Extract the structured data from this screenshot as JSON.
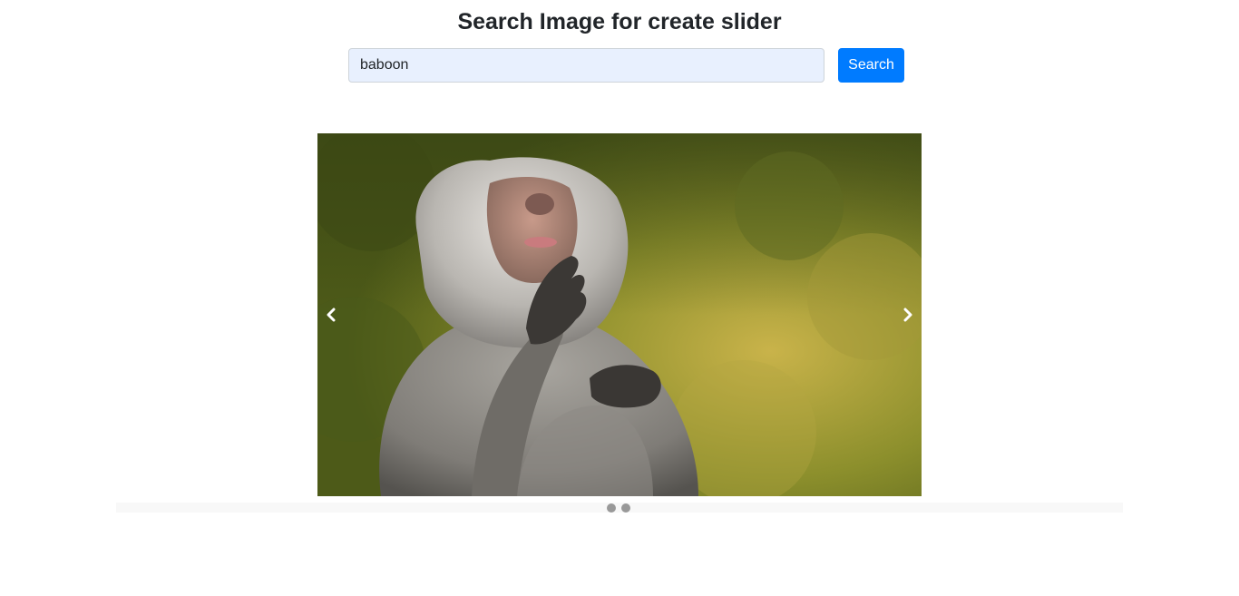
{
  "header": {
    "title": "Search Image for create slider"
  },
  "search": {
    "value": "baboon",
    "button_label": "Search"
  },
  "slider": {
    "prev_icon": "chevron-left-icon",
    "next_icon": "chevron-right-icon",
    "slide_count": 2,
    "active_index": 0
  },
  "colors": {
    "accent": "#007bff",
    "input_bg": "#e8f0fe",
    "dot": "#999999"
  }
}
